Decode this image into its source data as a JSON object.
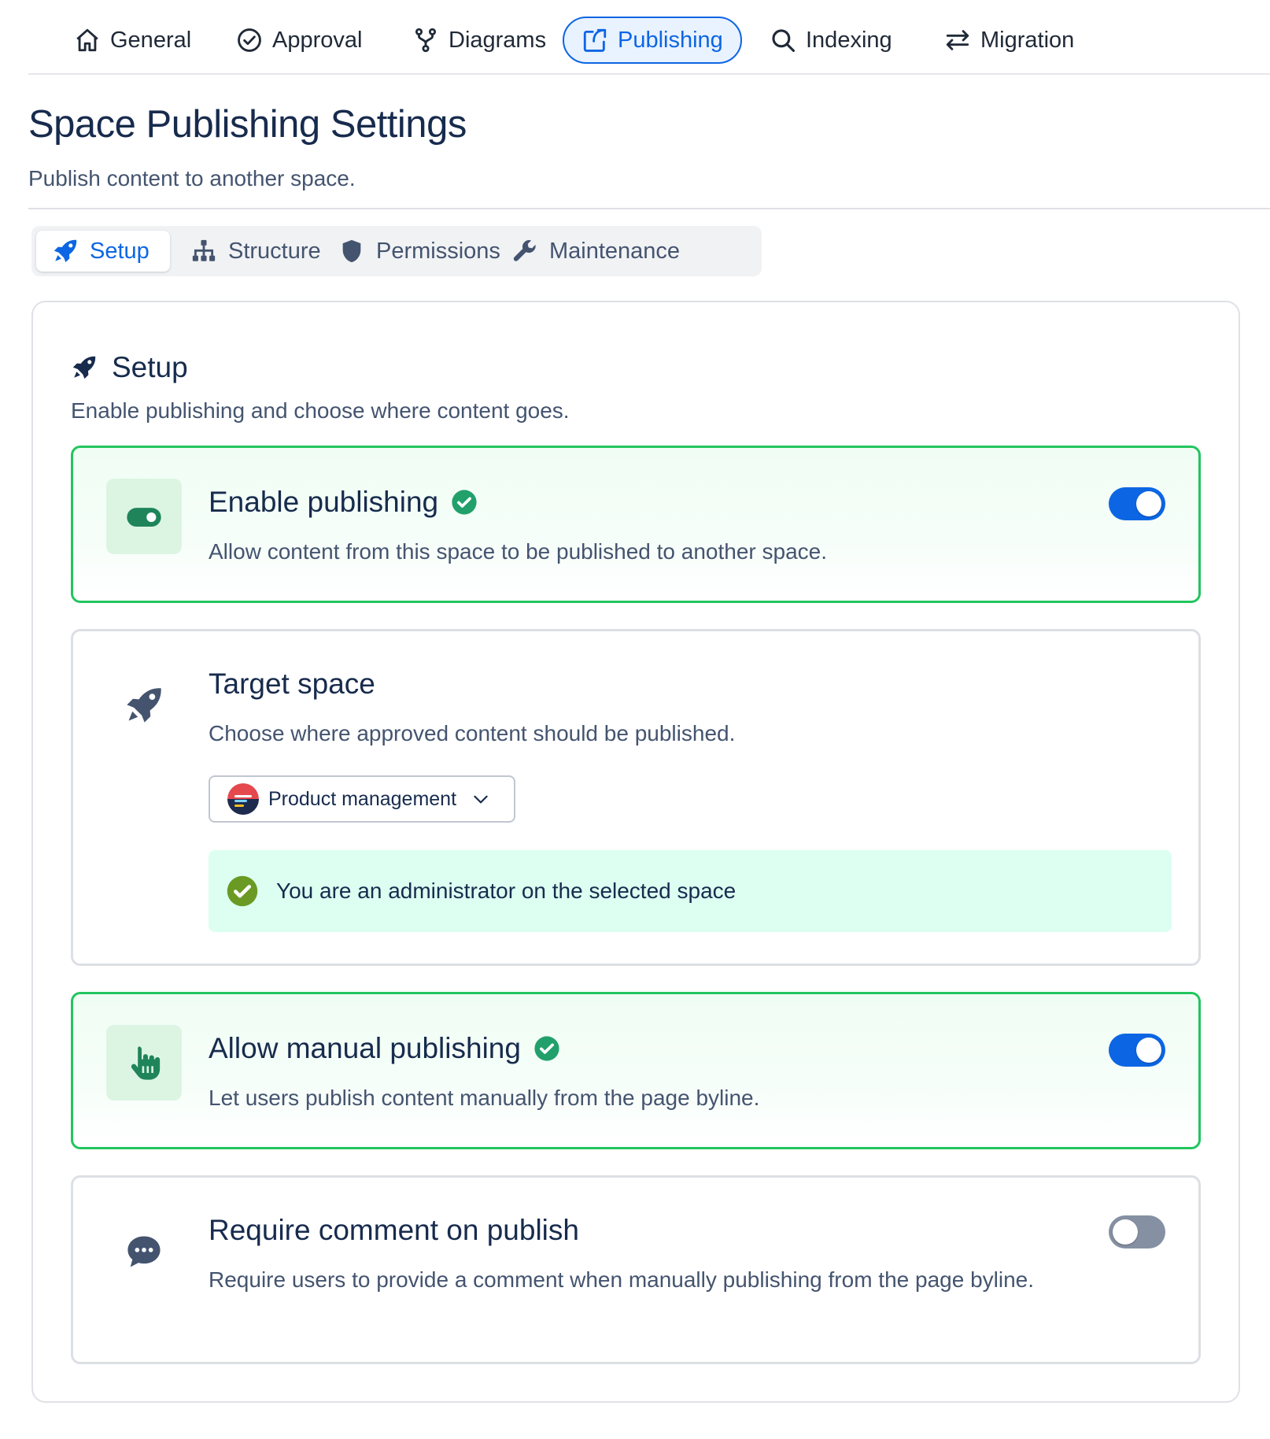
{
  "top_nav": {
    "tabs": [
      {
        "label": "General",
        "icon": "home-icon"
      },
      {
        "label": "Approval",
        "icon": "check-circle-icon"
      },
      {
        "label": "Diagrams",
        "icon": "fork-icon"
      },
      {
        "label": "Publishing",
        "icon": "share-icon",
        "active": true
      },
      {
        "label": "Indexing",
        "icon": "search-icon"
      },
      {
        "label": "Migration",
        "icon": "arrows-swap-icon"
      }
    ]
  },
  "header": {
    "title": "Space Publishing Settings",
    "subtitle": "Publish content to another space."
  },
  "sub_tabs": [
    {
      "label": "Setup",
      "icon": "rocket-icon",
      "active": true
    },
    {
      "label": "Structure",
      "icon": "sitemap-icon"
    },
    {
      "label": "Permissions",
      "icon": "shield-icon"
    },
    {
      "label": "Maintenance",
      "icon": "wrench-icon"
    }
  ],
  "section": {
    "title": "Setup",
    "description": "Enable publishing and choose where content goes."
  },
  "cards": {
    "enable_publishing": {
      "title": "Enable publishing",
      "description": "Allow content from this space to be published to another space.",
      "enabled": true
    },
    "target_space": {
      "title": "Target space",
      "description": "Choose where approved content should be published.",
      "selected_space": "Product management",
      "status_message": "You are an administrator on the selected space"
    },
    "manual_publishing": {
      "title": "Allow manual publishing",
      "description": "Let users publish content manually from the page byline.",
      "enabled": true
    },
    "require_comment": {
      "title": "Require comment on publish",
      "description": "Require users to provide a comment when manually publishing from the page byline.",
      "enabled": false
    }
  },
  "colors": {
    "accent": "#0c66e4",
    "success_border": "#22c55e",
    "success_icon": "#1f845a",
    "check_badge": "#22a06b",
    "banner_bg": "#dcfff1"
  }
}
